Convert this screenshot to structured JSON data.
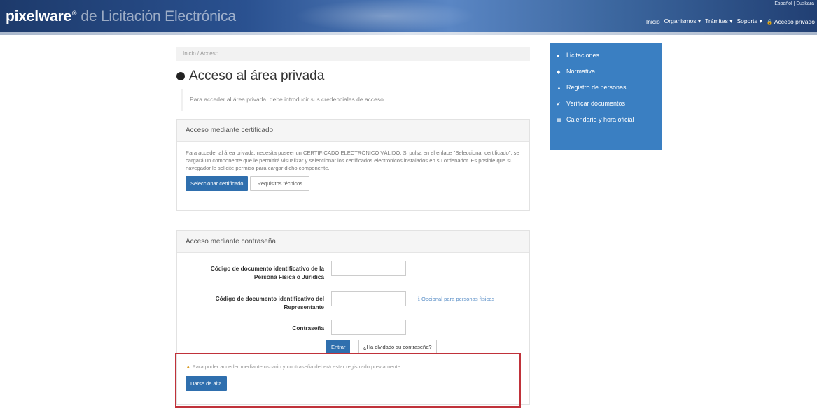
{
  "header": {
    "brand": "pixelware",
    "brand_mark": "®",
    "brand_subtitle": "de Licitación Electrónica",
    "language": "Español | Euskara",
    "nav": [
      "Inicio",
      "Organismos ▾",
      "Trámites ▾",
      "Soporte ▾",
      "Acceso privado"
    ]
  },
  "breadcrumb": "Inicio / Acceso",
  "page": {
    "title": "Acceso al área privada",
    "intro": "Para acceder al área privada, debe introducir sus credenciales de acceso"
  },
  "certificate_panel": {
    "heading": "Acceso mediante certificado",
    "text": "Para acceder al área privada, necesita poseer un CERTIFICADO ELECTRÓNICO VÁLIDO. Si pulsa en el enlace \"Seleccionar certificado\", se cargará un componente que le permitirá visualizar y seleccionar los certificados electrónicos instalados en su ordenador. Es posible que su navegador le solicite permiso para cargar dicho componente.",
    "select_button": "Seleccionar certificado",
    "requirements_button": "Requisitos técnicos"
  },
  "password_panel": {
    "heading": "Acceso mediante contraseña",
    "field1_label": "Código de documento identificativo de la Persona Física o Jurídica",
    "field2_label": "Código de documento identificativo del Representante",
    "field2_hint": "Opcional para personas físicas",
    "field3_label": "Contraseña",
    "enter_button": "Entrar",
    "forgot_button": "¿Ha olvidado su contraseña?",
    "note": "Para poder acceder mediante usuario y contraseña deberá estar registrado previamente.",
    "register_button": "Darse de alta"
  },
  "sidebar": {
    "items": [
      {
        "label": "Licitaciones",
        "icon": "list-icon"
      },
      {
        "label": "Normativa",
        "icon": "book-icon"
      },
      {
        "label": "Registro de personas",
        "icon": "user-icon"
      },
      {
        "label": "Verificar documentos",
        "icon": "check-icon"
      },
      {
        "label": "Calendario y hora oficial",
        "icon": "calendar-icon"
      }
    ]
  },
  "colors": {
    "header": "#2a5190",
    "sidebar": "#3a7fc2",
    "primary_button": "#2f6fae",
    "highlight": "#c0323a"
  }
}
